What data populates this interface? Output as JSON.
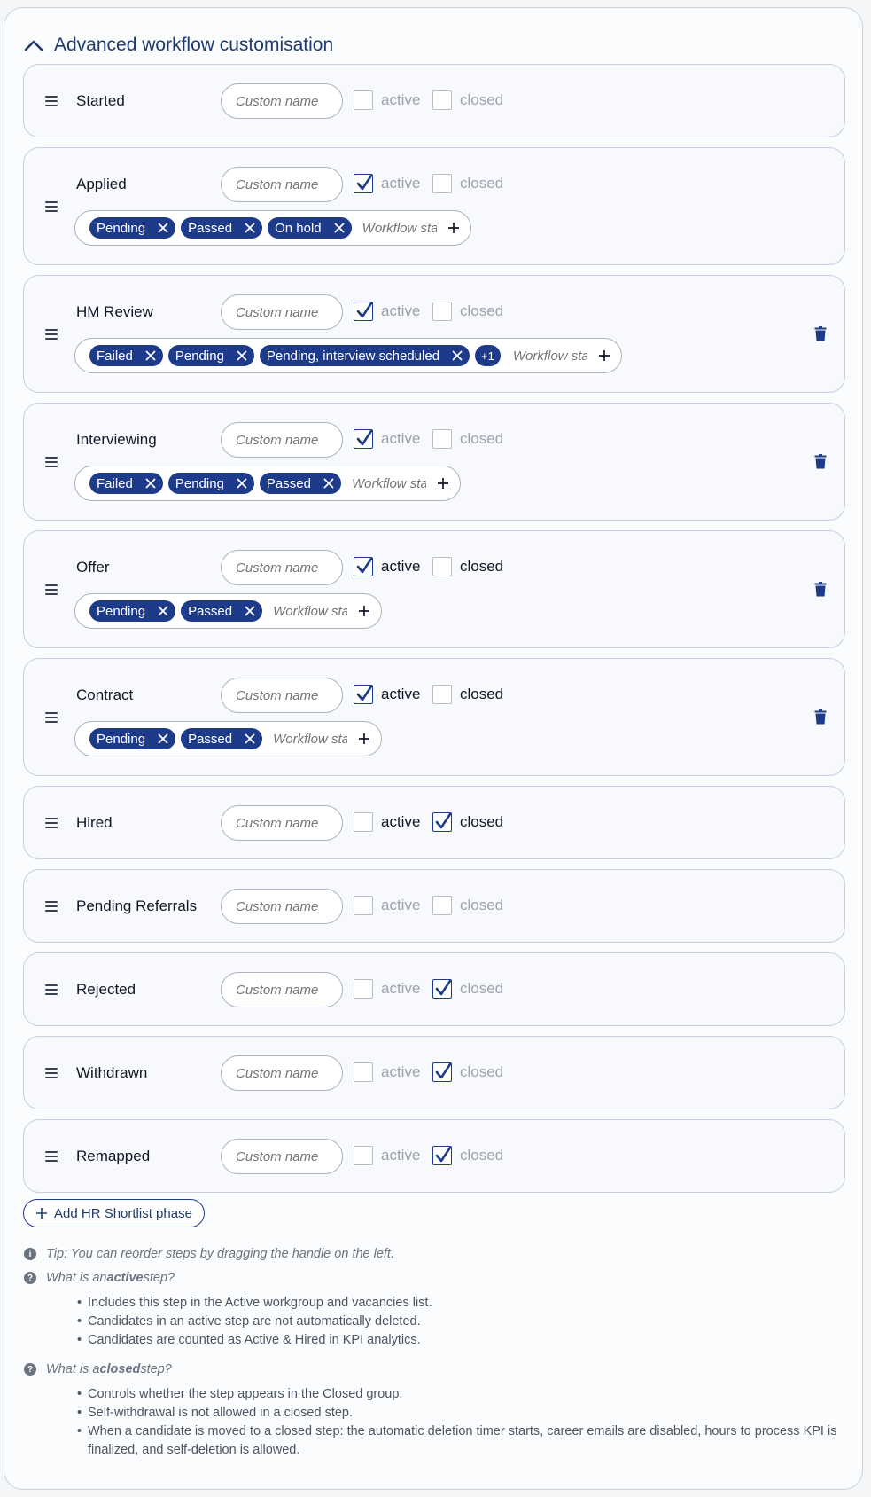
{
  "section": {
    "title": "Advanced workflow customisation"
  },
  "custom_name_placeholder": "Custom name",
  "workflow_placeholder": "Workflow sta",
  "active_label": "active",
  "closed_label": "closed",
  "steps": [
    {
      "name": "Started",
      "active": false,
      "closed": false,
      "enabled": false,
      "tags": [],
      "more": "",
      "deletable": false
    },
    {
      "name": "Applied",
      "active": true,
      "closed": false,
      "enabled": false,
      "tags": [
        "Pending",
        "Passed",
        "On hold"
      ],
      "more": "",
      "deletable": false
    },
    {
      "name": "HM Review",
      "active": true,
      "closed": false,
      "enabled": false,
      "tags": [
        "Failed",
        "Pending",
        "Pending, interview scheduled"
      ],
      "more": "+1",
      "deletable": true
    },
    {
      "name": "Interviewing",
      "active": true,
      "closed": false,
      "enabled": false,
      "tags": [
        "Failed",
        "Pending",
        "Passed"
      ],
      "more": "",
      "deletable": true
    },
    {
      "name": "Offer",
      "active": true,
      "closed": false,
      "enabled": true,
      "tags": [
        "Pending",
        "Passed"
      ],
      "more": "",
      "deletable": true
    },
    {
      "name": "Contract",
      "active": true,
      "closed": false,
      "enabled": true,
      "tags": [
        "Pending",
        "Passed"
      ],
      "more": "",
      "deletable": true
    },
    {
      "name": "Hired",
      "active": false,
      "closed": true,
      "enabled": true,
      "tags": [],
      "more": "",
      "deletable": false
    },
    {
      "name": "Pending Referrals",
      "active": false,
      "closed": false,
      "enabled": false,
      "tags": [],
      "more": "",
      "deletable": false
    },
    {
      "name": "Rejected",
      "active": false,
      "closed": true,
      "enabled": false,
      "tags": [],
      "more": "",
      "deletable": false
    },
    {
      "name": "Withdrawn",
      "active": false,
      "closed": true,
      "enabled": false,
      "tags": [],
      "more": "",
      "deletable": false
    },
    {
      "name": "Remapped",
      "active": false,
      "closed": true,
      "enabled": false,
      "tags": [],
      "more": "",
      "deletable": false
    }
  ],
  "add_phase_label": "Add HR Shortlist phase",
  "help": {
    "tip": "Tip: You can reorder steps by dragging the handle on the left.",
    "active_q_prefix": "What is an ",
    "active_q_bold": "active",
    "active_q_suffix": " step?",
    "active_points": [
      "Includes this step in the Active workgroup and vacancies list.",
      "Candidates in an active step are not automatically deleted.",
      "Candidates are counted as Active & Hired in KPI analytics."
    ],
    "closed_q_prefix": "What is a ",
    "closed_q_bold": "closed",
    "closed_q_suffix": " step?",
    "closed_points": [
      "Controls whether the step appears in the Closed group.",
      "Self-withdrawal is not allowed in a closed step.",
      "When a candidate is moved to a closed step: the automatic deletion timer starts, career emails are disabled, hours to process KPI is finalized, and self-deletion is allowed."
    ]
  },
  "colors": {
    "accent": "#1e3a8a",
    "border": "#c5d0de",
    "muted": "#9ca3af"
  }
}
